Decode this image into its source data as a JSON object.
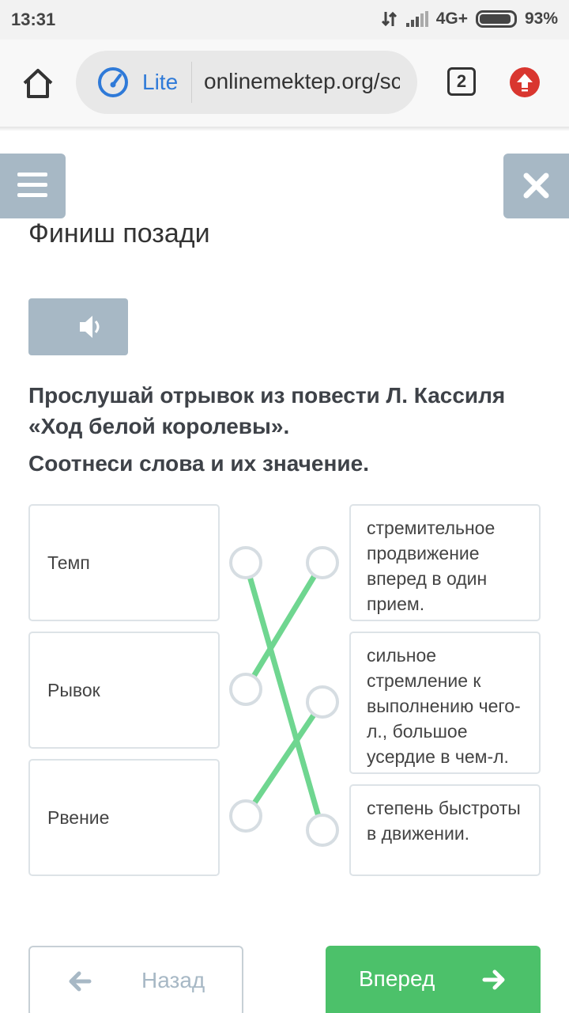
{
  "status_bar": {
    "time": "13:31",
    "network": "4G+",
    "battery": "93%",
    "battery_level": 0.93
  },
  "browser": {
    "lite_label": "Lite",
    "url": "onlinemektep.org/sc",
    "tab_count": "2"
  },
  "page": {
    "title": "Финиш позади",
    "instruction_1": "Прослушай отрывок из повести Л. Кассиля «Ход белой королевы».",
    "instruction_2": "Соотнеси слова и их значение.",
    "words": [
      "Темп",
      "Рывок",
      "Рвение"
    ],
    "meanings": [
      "стремительное продвижение вперед в один прием.",
      "сильное стремление к выполнению чего-л., большое усердие в чем-л.",
      "степень быстроты в движении."
    ],
    "matches": [
      {
        "word": "Темп",
        "meaning": "степень быстроты в движении."
      },
      {
        "word": "Рывок",
        "meaning": "стремительное продвижение вперед в один прием."
      },
      {
        "word": "Рвение",
        "meaning": "сильное стремление к выполнению чего-л., большое усердие в чем-л."
      }
    ],
    "back_label": "Назад",
    "next_label": "Вперед"
  },
  "colors": {
    "accent_green": "#4cc16a",
    "match_line": "#6fd690",
    "muted_button": "#a7b8c5",
    "lite_blue": "#2f7ad8",
    "update_red": "#d9362f"
  }
}
